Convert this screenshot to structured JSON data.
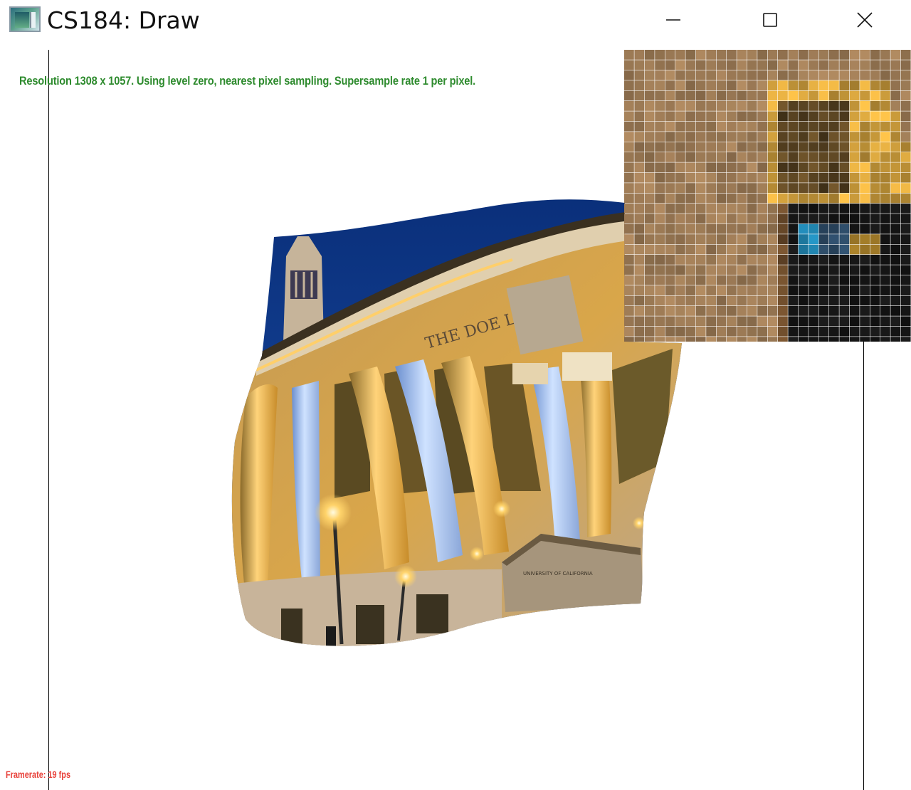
{
  "window": {
    "title": "CS184: Draw",
    "icon": "app-icon",
    "controls": [
      "minimize-icon",
      "maximize-icon",
      "close-icon"
    ]
  },
  "canvas": {
    "status": "Resolution 1308 x 1057. Using level zero, nearest pixel sampling. Supersample rate 1 per pixel.",
    "framerate": "Framerate: 19 fps",
    "status_color": "#2e8b2e",
    "framerate_color": "#e8413a",
    "background": "#ffffff"
  },
  "image": {
    "carved_text": "THE DOE LIBRARY",
    "small_plaque": "UNIVERSITY OF CALIFORNIA"
  },
  "colors": {
    "sky": "#0b3a8c",
    "stone_warm": "#e9b04a",
    "stone_cool": "#a9b8d8",
    "window_dark": "#5a4a22",
    "pixel_stone": "#9c7a55",
    "pixel_gold": "#c99a3a",
    "pixel_dark": "#141414"
  }
}
